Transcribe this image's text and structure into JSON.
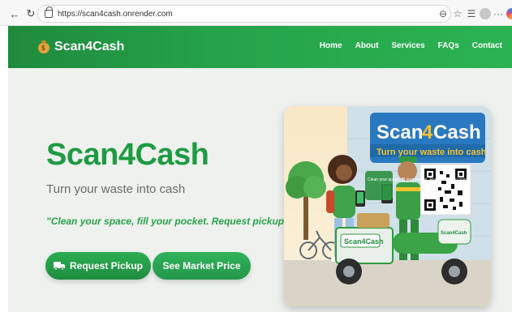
{
  "browser": {
    "url": "https://scan4cash.onrender.com"
  },
  "site": {
    "logo_text": "Scan4Cash",
    "nav": [
      "Home",
      "About",
      "Services",
      "FAQs",
      "Contact"
    ]
  },
  "hero": {
    "title": "Scan4Cash",
    "subtitle": "Turn your waste into cash",
    "quote": "\"Clean your space, fill your pocket. Request pickup now!\"",
    "primary_button": "Request Pickup",
    "secondary_button": "See Market Price"
  },
  "illustration": {
    "banner_title_part1": "Scan",
    "banner_title_part2": "4",
    "banner_title_part3": "Cash",
    "banner_subtitle": "Turn your waste into cash",
    "cart_label": "Scan4Cash",
    "box_label": "Scan4Cash",
    "phone_text": "Clean your space, fill your pocket. Request pickup now!"
  },
  "colors": {
    "brand_green": "#1f9a43",
    "header_green": "#25a24a",
    "hero_bg": "#eef1ee"
  }
}
